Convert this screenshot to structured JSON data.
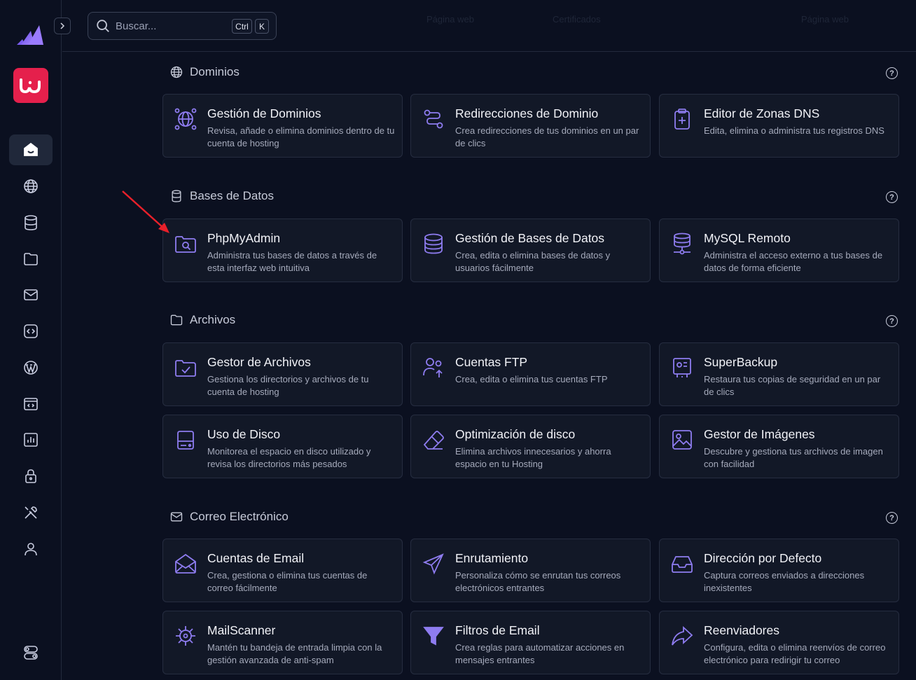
{
  "search": {
    "placeholder": "Buscar...",
    "shortcut_ctrl": "Ctrl",
    "shortcut_key": "K"
  },
  "topbar": {
    "faded_items": [
      "Página web",
      "Certificados",
      "Página web"
    ]
  },
  "sidebar": {
    "brand_letter": "w",
    "items": [
      {
        "name": "home-icon"
      },
      {
        "name": "globe-icon"
      },
      {
        "name": "database-icon"
      },
      {
        "name": "folder-icon"
      },
      {
        "name": "mail-icon"
      },
      {
        "name": "code-icon"
      },
      {
        "name": "wordpress-icon"
      },
      {
        "name": "app-window-icon"
      },
      {
        "name": "chart-icon"
      },
      {
        "name": "lock-icon"
      },
      {
        "name": "tools-icon"
      },
      {
        "name": "user-icon"
      },
      {
        "name": "settings-toggle-icon"
      }
    ]
  },
  "sections": [
    {
      "title": "Dominios",
      "cards": [
        {
          "title": "Gestión de Dominios",
          "desc": "Revisa, añade o elimina dominios dentro de tu cuenta de hosting",
          "icon": "globe-network-icon"
        },
        {
          "title": "Redirecciones de Dominio",
          "desc": "Crea redirecciones de tus dominios en un par de clics",
          "icon": "route-icon"
        },
        {
          "title": "Editor de Zonas DNS",
          "desc": "Edita, elimina o administra tus registros DNS",
          "icon": "clipboard-plus-icon"
        }
      ]
    },
    {
      "title": "Bases de Datos",
      "cards": [
        {
          "title": "PhpMyAdmin",
          "desc": "Administra tus bases de datos a través de esta interfaz web intuitiva",
          "icon": "folder-search-icon"
        },
        {
          "title": "Gestión de Bases de Datos",
          "desc": "Crea, edita o elimina bases de datos y usuarios fácilmente",
          "icon": "database-icon"
        },
        {
          "title": "MySQL Remoto",
          "desc": "Administra el acceso externo a tus bases de datos de forma eficiente",
          "icon": "database-network-icon"
        }
      ]
    },
    {
      "title": "Archivos",
      "cards": [
        {
          "title": "Gestor de Archivos",
          "desc": "Gestiona los directorios y archivos de tu cuenta de hosting",
          "icon": "folder-check-icon"
        },
        {
          "title": "Cuentas FTP",
          "desc": "Crea, edita o elimina tus cuentas FTP",
          "icon": "users-upload-icon"
        },
        {
          "title": "SuperBackup",
          "desc": "Restaura tus copias de seguridad en un par de clics",
          "icon": "backup-icon"
        },
        {
          "title": "Uso de Disco",
          "desc": "Monitorea el espacio en disco utilizado y revisa los directorios más pesados",
          "icon": "hard-drive-icon"
        },
        {
          "title": "Optimización de disco",
          "desc": "Elimina archivos innecesarios y ahorra espacio en tu Hosting",
          "icon": "eraser-icon"
        },
        {
          "title": "Gestor de Imágenes",
          "desc": "Descubre y gestiona tus archivos de imagen con facilidad",
          "icon": "image-icon"
        }
      ]
    },
    {
      "title": "Correo Electrónico",
      "cards": [
        {
          "title": "Cuentas de Email",
          "desc": "Crea, gestiona o elimina tus cuentas de correo fácilmente",
          "icon": "envelope-open-icon"
        },
        {
          "title": "Enrutamiento",
          "desc": "Personaliza cómo se enrutan tus correos electrónicos entrantes",
          "icon": "send-icon"
        },
        {
          "title": "Dirección por Defecto",
          "desc": "Captura correos enviados a direcciones inexistentes",
          "icon": "inbox-icon"
        },
        {
          "title": "MailScanner",
          "desc": "Mantén tu bandeja de entrada limpia con la gestión avanzada de anti-spam",
          "icon": "virus-icon"
        },
        {
          "title": "Filtros de Email",
          "desc": "Crea reglas para automatizar acciones en mensajes entrantes",
          "icon": "filter-icon"
        },
        {
          "title": "Reenviadores",
          "desc": "Configura, edita o elimina reenvíos de correo electrónico para redirigir tu correo",
          "icon": "forward-icon"
        }
      ]
    }
  ],
  "colors": {
    "accent": "#8e7cf0",
    "brand": "#e5204c",
    "annotation_arrow": "#e8202a"
  }
}
